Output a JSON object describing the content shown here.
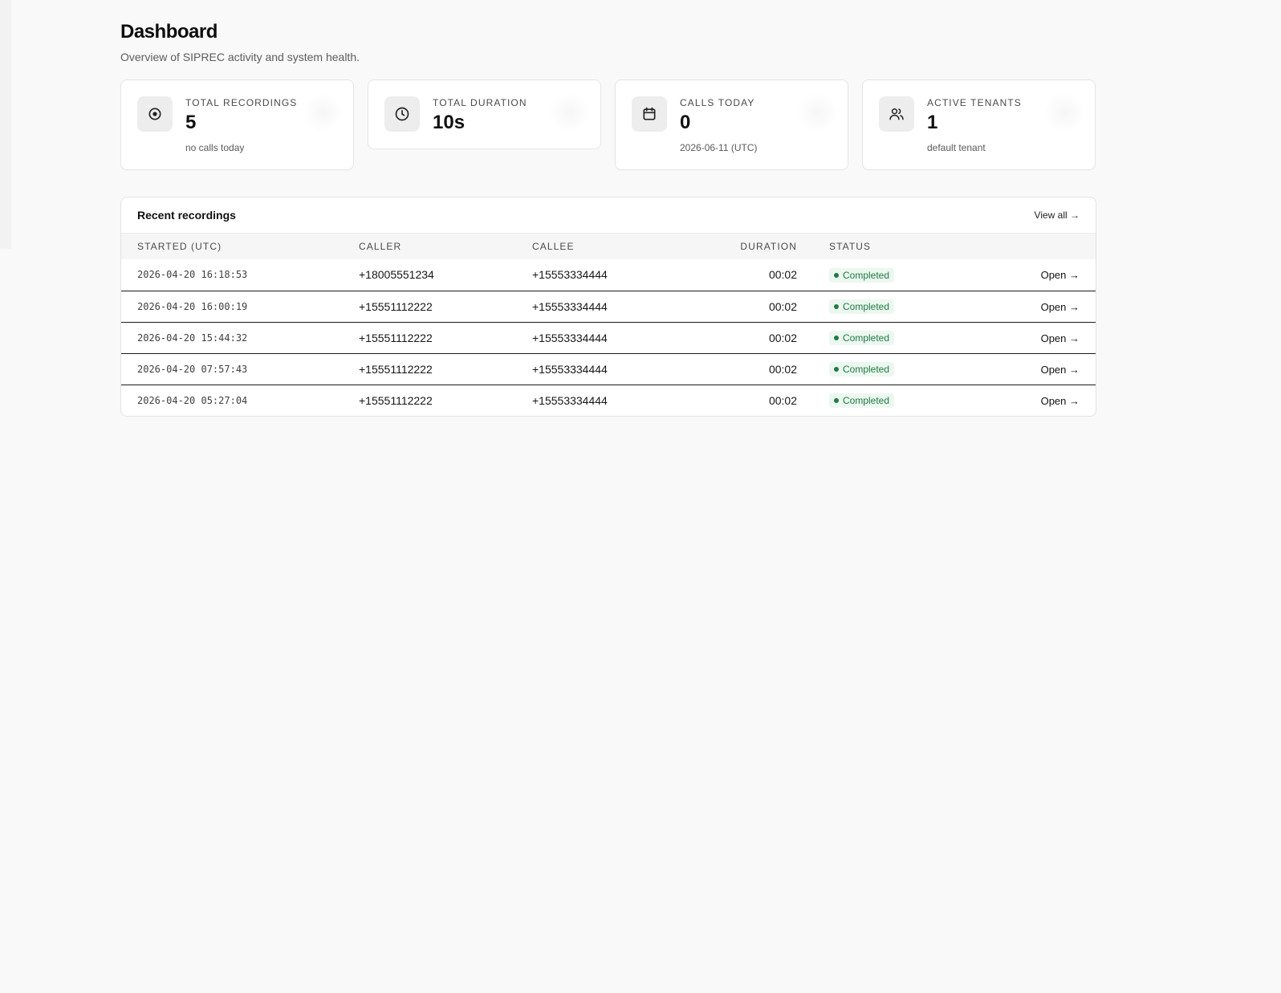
{
  "header": {
    "title": "Dashboard",
    "subtitle": "Overview of SIPREC activity and system health."
  },
  "stats": [
    {
      "icon": "record-icon",
      "label": "TOTAL RECORDINGS",
      "value": "5",
      "sub": "no calls today"
    },
    {
      "icon": "clock-icon",
      "label": "TOTAL DURATION",
      "value": "10s",
      "sub": ""
    },
    {
      "icon": "calendar-icon",
      "label": "CALLS TODAY",
      "value": "0",
      "sub": "2026-06-11 (UTC)"
    },
    {
      "icon": "users-icon",
      "label": "ACTIVE TENANTS",
      "value": "1",
      "sub": "default tenant"
    }
  ],
  "recent": {
    "title": "Recent recordings",
    "view_all": "View all →",
    "columns": {
      "started": "STARTED (UTC)",
      "caller": "CALLER",
      "callee": "CALLEE",
      "duration": "DURATION",
      "status": "STATUS"
    },
    "rows": [
      {
        "started": "2026-04-20 16:18:53",
        "caller": "+18005551234",
        "callee": "+15553334444",
        "duration": "00:02",
        "status": "Completed",
        "action": "Open →"
      },
      {
        "started": "2026-04-20 16:00:19",
        "caller": "+15551112222",
        "callee": "+15553334444",
        "duration": "00:02",
        "status": "Completed",
        "action": "Open →"
      },
      {
        "started": "2026-04-20 15:44:32",
        "caller": "+15551112222",
        "callee": "+15553334444",
        "duration": "00:02",
        "status": "Completed",
        "action": "Open →"
      },
      {
        "started": "2026-04-20 07:57:43",
        "caller": "+15551112222",
        "callee": "+15553334444",
        "duration": "00:02",
        "status": "Completed",
        "action": "Open →"
      },
      {
        "started": "2026-04-20 05:27:04",
        "caller": "+15551112222",
        "callee": "+15553334444",
        "duration": "00:02",
        "status": "Completed",
        "action": "Open →"
      }
    ]
  },
  "colors": {
    "background": "#f9f9f9",
    "status_completed": "#1f7a43",
    "status_completed_bg": "#ecf7f0"
  }
}
